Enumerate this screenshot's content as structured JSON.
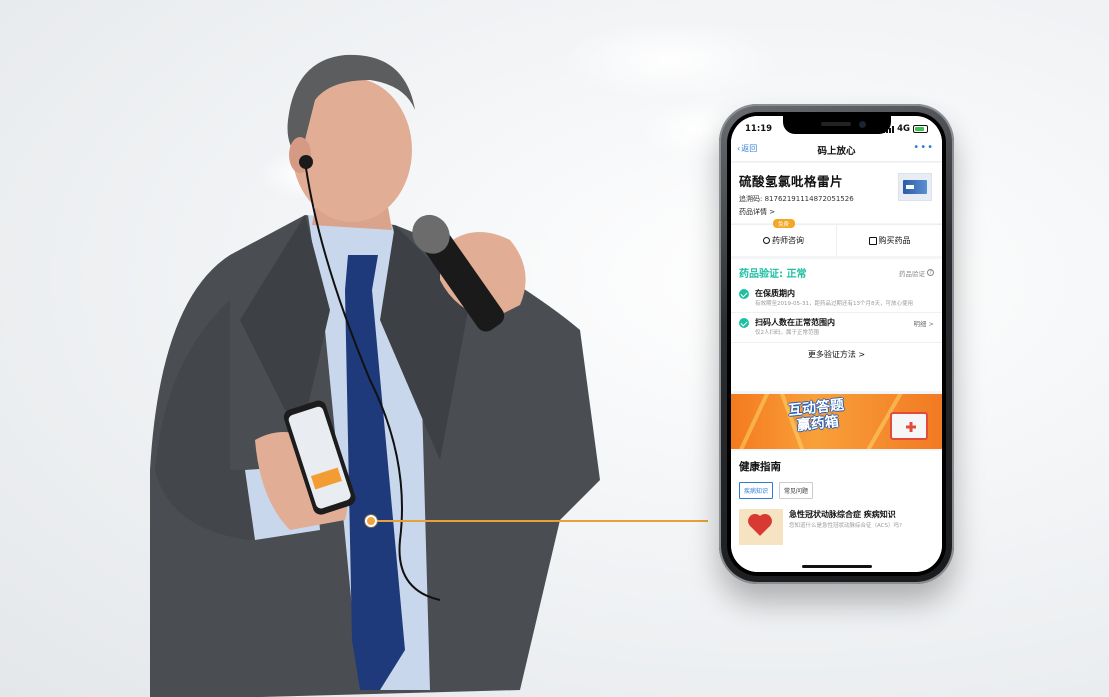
{
  "phone": {
    "status": {
      "time": "11:19",
      "network": "4G"
    },
    "nav": {
      "back_label": "返回",
      "title": "码上放心",
      "more_label": "•••"
    },
    "drug": {
      "name": "硫酸氢氯吡格雷片",
      "trace_code": "追溯码: 81762191114872051526",
      "detail_link": "药品详情 >"
    },
    "actions": {
      "free_badge": "免费",
      "consult_label": "药师咨询",
      "buy_label": "购买药品"
    },
    "verify": {
      "title": "药品验证: 正常",
      "help_label": "药品验证",
      "items": [
        {
          "title": "在保质期内",
          "desc": "有效期至2019-05-31，距药品过期还有13个月8天，可放心使用"
        },
        {
          "title": "扫码人数在正常范围内",
          "desc": "仅2人扫码，属于正常范围",
          "link": "明细 >"
        }
      ],
      "more_methods": "更多验证方法 >"
    },
    "banner": {
      "line1": "互动答题",
      "line2": "赢药箱"
    },
    "health": {
      "title": "健康指南",
      "tabs": [
        "疾病知识",
        "常见问题"
      ],
      "article": {
        "title": "急性冠状动脉综合症 疾病知识",
        "desc": "您知道什么是急性冠状动脉综合征（ACS）吗?"
      }
    }
  },
  "colors": {
    "accent_teal": "#1ec0a4",
    "link_blue": "#2e7bd8",
    "connector_orange": "#e8a13a",
    "suit_gray": "#4a4d52",
    "tie_navy": "#1f3a7a"
  }
}
